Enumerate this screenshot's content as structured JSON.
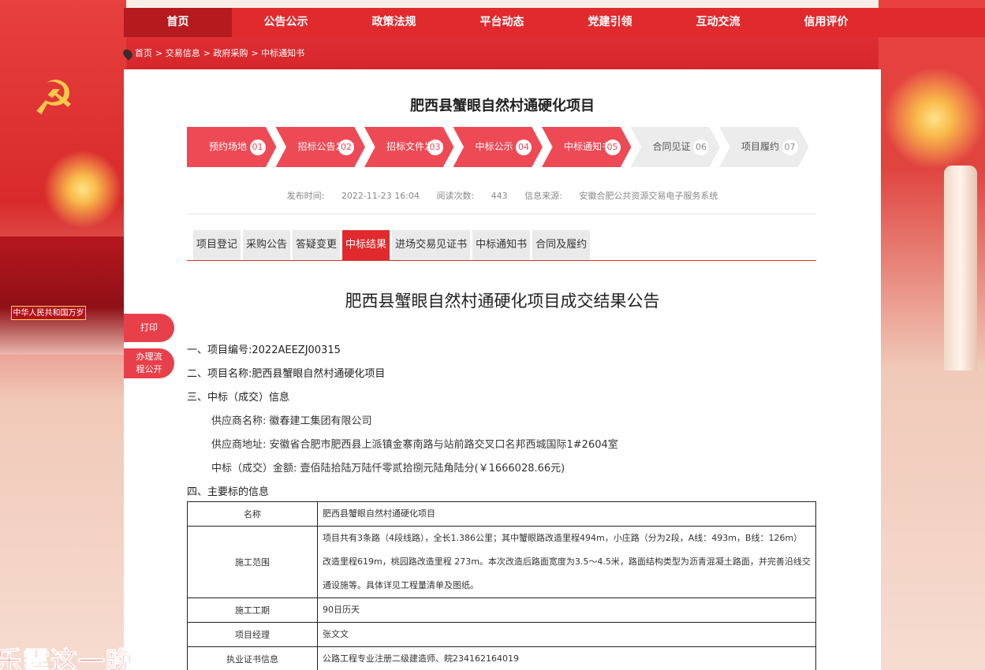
{
  "nav": [
    "首页",
    "公告公示",
    "政策法规",
    "平台动态",
    "党建引领",
    "互动交流",
    "信用评价"
  ],
  "breadcrumb": [
    "首页",
    "> 交易信息",
    "> 政府采购",
    "> 中标通知书"
  ],
  "decor": {
    "gate_sign": "中华人民共和国万岁",
    "watermark": "乐霆这一晚"
  },
  "page_title": "肥西县蟹眼自然村通硬化项目",
  "steps": [
    {
      "label": "预约场地",
      "num": "01",
      "done": true
    },
    {
      "label": "招标公告发布",
      "num": "02",
      "done": true
    },
    {
      "label": "招标文件发布",
      "num": "03",
      "done": true
    },
    {
      "label": "中标公示",
      "num": "04",
      "done": true
    },
    {
      "label": "中标通知书",
      "num": "05",
      "done": true
    },
    {
      "label": "合同见证",
      "num": "06",
      "done": false
    },
    {
      "label": "项目履约",
      "num": "07",
      "done": false
    }
  ],
  "meta": {
    "publish_label": "发布时间:",
    "publish_value": "2022-11-23 16:04",
    "views_label": "阅读次数:",
    "views_value": "443",
    "source_label": "信息来源:",
    "source_value": "安徽合肥公共资源交易电子服务系统"
  },
  "tabs": [
    "项目登记",
    "采购公告",
    "答疑变更",
    "中标结果",
    "进场交易见证书",
    "中标通知书",
    "合同及履约"
  ],
  "active_tab": "中标结果",
  "side": {
    "print": "打印",
    "process": "办理流程公开"
  },
  "doc": {
    "title": "肥西县蟹眼自然村通硬化项目成交结果公告",
    "l1": "一、项目编号:2022AEEZJ00315",
    "l2": "二、项目名称:肥西县蟹眼自然村通硬化项目",
    "l3": "三、中标（成交）信息",
    "l3a": "供应商名称: 徽春建工集团有限公司",
    "l3b": "供应商地址: 安徽省合肥市肥西县上派镇金寨南路与站前路交叉口名邦西城国际1#2604室",
    "l3c": "中标（成交）金额: 壹佰陆拾陆万陆仟零贰拾捌元陆角陆分(￥1666028.66元)",
    "l4": "四、主要标的信息"
  },
  "table": [
    {
      "k": "名称",
      "v": "肥西县蟹眼自然村通硬化项目"
    },
    {
      "k": "施工范围",
      "v": "项目共有3条路（4段线路），全长1.386公里；其中蟹眼路改造里程494m，小庄路（分为2段，A线：493m，B线：126m）改造里程619m，桃园路改造里程 273m。本次改造后路面宽度为3.5～4.5米，路面结构类型为沥青混凝土路面，并完善沿线交通设施等。具体详见工程量清单及图纸。"
    },
    {
      "k": "施工工期",
      "v": "90日历天"
    },
    {
      "k": "项目经理",
      "v": "张文文"
    },
    {
      "k": "执业证书信息",
      "v": "公路工程专业注册二级建造师、皖234162164019"
    }
  ]
}
